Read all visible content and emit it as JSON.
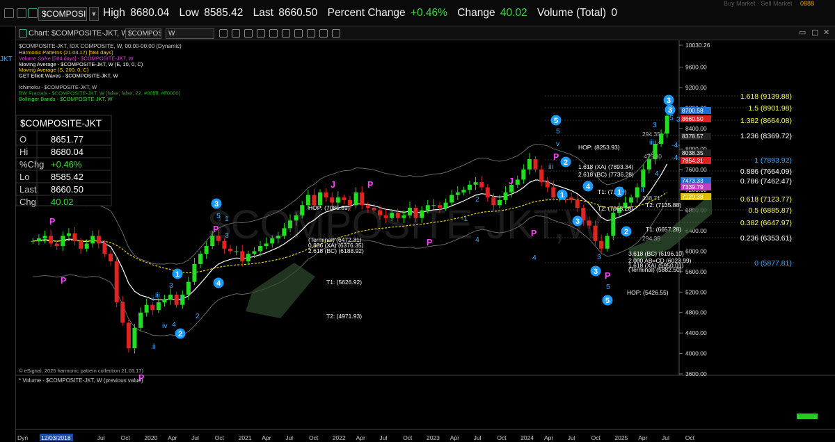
{
  "quote_bar": {
    "symbol": "$COMPOSI",
    "high_label": "High",
    "high": "8680.04",
    "low_label": "Low",
    "low": "8585.42",
    "last_label": "Last",
    "last": "8660.50",
    "pct_label": "Percent Change",
    "pct": "+0.46%",
    "chg_label": "Change",
    "chg": "40.02",
    "vol_label": "Volume (Total)",
    "vol": "0",
    "right_hint": "Buy Market · Sell Market",
    "right_badge": "0888",
    "positive_color": "#3cd63c"
  },
  "window": {
    "title": "Chart: $COMPOSITE-JKT, W",
    "symbol_input": "$COMPOSI",
    "interval_input": "W",
    "left_strip_label": "JKT"
  },
  "chart_data": {
    "type": "candlestick",
    "title": "$COMPOSITE-JKT, IDX COMPOSITE, W, 00:00-00:00 (Dynamic)",
    "watermark": "$COMPOSITE-JKT,W",
    "copyright": "© eSignal, 2025 harmonic pattern collection 21.03.17)",
    "indicators": [
      {
        "text": "Harmonic Patterns (21.03.17) [584 days]",
        "color": "#ffd000"
      },
      {
        "text": "Volume Spike [584 days] - $COMPOSITE-JKT, W",
        "color": "#d040d0"
      },
      {
        "text": "Moving Average - $COMPOSITE-JKT, W (E, 10, 0, C)",
        "color": "#ffffff"
      },
      {
        "text": "Moving Average (S, 200, 0, C)",
        "color": "#ffd000"
      },
      {
        "text": "GET Elliott Waves - $COMPOSITE-JKT, W",
        "color": "#ffffff"
      },
      {
        "text": "Ichimoku - $COMPOSITE-JKT, W",
        "color": "#cccccc"
      },
      {
        "text": "BW Fractals - $COMPOSITE-JKT, W (false, false, 22, #00ffff, #ff0000)",
        "color": "#22aa22"
      },
      {
        "text": "Bollinger Bands - $COMPOSITE-JKT, W",
        "color": "#44dd44"
      }
    ],
    "info_box": {
      "symbol": "$COMPOSITE-JKT",
      "rows": [
        {
          "label": "O",
          "value": "8651.77",
          "color": "#ffffff"
        },
        {
          "label": "Hi",
          "value": "8680.04",
          "color": "#ffffff"
        },
        {
          "label": "%Chg",
          "value": "+0.46%",
          "color": "#3cd63c"
        },
        {
          "label": "Lo",
          "value": "8585.42",
          "color": "#ffffff"
        },
        {
          "label": "Last",
          "value": "8660.50",
          "color": "#ffffff"
        },
        {
          "label": "Chg",
          "value": "40.02",
          "color": "#3cd63c"
        }
      ]
    },
    "y_axis_ticks": [
      "10030.26",
      "9600.00",
      "9200.00",
      "8800.00",
      "8400.00",
      "8000.00",
      "7600.00",
      "7200.00",
      "6800.00",
      "6400.00",
      "6000.00",
      "5600.00",
      "5200.00",
      "4800.00",
      "4400.00",
      "4000.00",
      "3600.00"
    ],
    "price_tags": [
      {
        "text": "8700.58",
        "bg": "#1f6fd0"
      },
      {
        "text": "8660.50",
        "bg": "#e02020"
      },
      {
        "text": "8378.57",
        "bg": "#222222"
      },
      {
        "text": "8038.35",
        "bg": "#222222"
      },
      {
        "text": "7854.31",
        "bg": "#e02020"
      },
      {
        "text": "7473.33",
        "bg": "#1f6fd0"
      },
      {
        "text": "7339.79",
        "bg": "#c040c0"
      },
      {
        "text": "7129.38",
        "bg": "#e0c000"
      }
    ],
    "fib_levels": [
      {
        "text": "1.618 (9139.88)",
        "color": "#ffff55"
      },
      {
        "text": "1.5 (8901.98)",
        "color": "#ffff55"
      },
      {
        "text": "1.382 (8664.08)",
        "color": "#ffff55"
      },
      {
        "text": "1.236 (8369.72)",
        "color": "#ffffff"
      },
      {
        "text": "1 (7893.92)",
        "color": "#3aa8ff"
      },
      {
        "text": "0.886 (7664.09)",
        "color": "#ffffff"
      },
      {
        "text": "0.786 (7462.47)",
        "color": "#ffffff"
      },
      {
        "text": "0.618 (7123.77)",
        "color": "#ffff55"
      },
      {
        "text": "0.5 (6885.87)",
        "color": "#ffff55"
      },
      {
        "text": "0.382 (6647.97)",
        "color": "#ffff55"
      },
      {
        "text": "0.236 (6353.61)",
        "color": "#ffffff"
      },
      {
        "text": "0 (5877.81)",
        "color": "#3aa8ff"
      }
    ],
    "harmonic_labels": [
      "HOP: (8253.93)",
      "1.618 (XA) (7893.34)",
      "2.618 (BC) (7736.28)",
      "T1: (7...07)",
      "T2: (7065.28)",
      "T2: (7135.88)",
      "T1: (6657.28)",
      "3.618 (BC) (6196.10)",
      "2.000 AB=CD (6023.99)",
      "1.618 (XA) (5950.01)",
      "(Terminal) (5882.50)",
      "HOP: (5426.55)",
      "HOP: (7085.89)",
      "(Terminal) (6472.31)",
      "0.886 (XA) (6376.35)",
      "2.618 (BC) (6188.92)",
      "T1: (5626.92)",
      "T2: (4971.93)",
      "294.35",
      "338.71",
      "294.35",
      "475.30"
    ],
    "wave_labels_blue_circle": [
      "3",
      "1",
      "2",
      "4",
      "3",
      "5",
      "2",
      "1",
      "3",
      "4",
      "1",
      "2",
      "3",
      "5",
      "3"
    ],
    "wave_labels_plain": [
      "5",
      "3",
      "5",
      "3",
      "i",
      "iii",
      "iv",
      "ii",
      "4",
      "2",
      "1",
      "5",
      "v",
      "iii",
      "4",
      "3",
      "5",
      "1",
      "ii",
      "iii",
      "3",
      "-4-",
      "-4-",
      "4",
      "5",
      "3",
      "-1",
      "2",
      "4"
    ],
    "pattern_labels": [
      "P",
      "P",
      "P",
      "P",
      "P",
      "P",
      "P",
      "P",
      "J",
      "J",
      "P"
    ],
    "x_axis_ticks": [
      "12/03/2018",
      "Jul",
      "Oct",
      "2020",
      "Apr",
      "Jul",
      "Oct",
      "2021",
      "Apr",
      "Jul",
      "Oct",
      "2022",
      "Apr",
      "Jul",
      "Oct",
      "2023",
      "Apr",
      "Jul",
      "Oct",
      "2024",
      "Apr",
      "Jul",
      "Oct",
      "2025",
      "Apr",
      "Jul",
      "Oct"
    ],
    "x_axis_prefix": "Dyn",
    "approx_closes": [
      6200,
      6250,
      6300,
      6150,
      6100,
      6300,
      6350,
      6200,
      6050,
      6150,
      6300,
      6150,
      5950,
      5800,
      5000,
      4600,
      4100,
      4500,
      4800,
      4950,
      4850,
      5000,
      5050,
      5150,
      4950,
      5150,
      5400,
      5750,
      5950,
      6100,
      6300,
      6200,
      6050,
      6000,
      6000,
      5800,
      5950,
      6000,
      6100,
      6150,
      6250,
      6300,
      6450,
      6600,
      6700,
      6900,
      7100,
      6900,
      7150,
      7050,
      6950,
      7050,
      7000,
      6900,
      7150,
      6900,
      6850,
      6800,
      6700,
      6650,
      6750,
      6650,
      6700,
      6850,
      6650,
      6800,
      6900,
      6900,
      6850,
      6950,
      7100,
      7150,
      7200,
      7300,
      7350,
      7250,
      7050,
      6900,
      7000,
      7150,
      7300,
      7400,
      7600,
      7800,
      7600,
      7350,
      7250,
      7050,
      7100,
      7050,
      7000,
      6850,
      6600,
      6500,
      6200,
      6050,
      6300,
      6750,
      6850,
      6950,
      7050,
      7250,
      7600,
      7800,
      8100,
      8300,
      8650
    ]
  },
  "volume_pane": {
    "title": "* Volume - $COMPOSITE-JKT, W (previous value)"
  }
}
